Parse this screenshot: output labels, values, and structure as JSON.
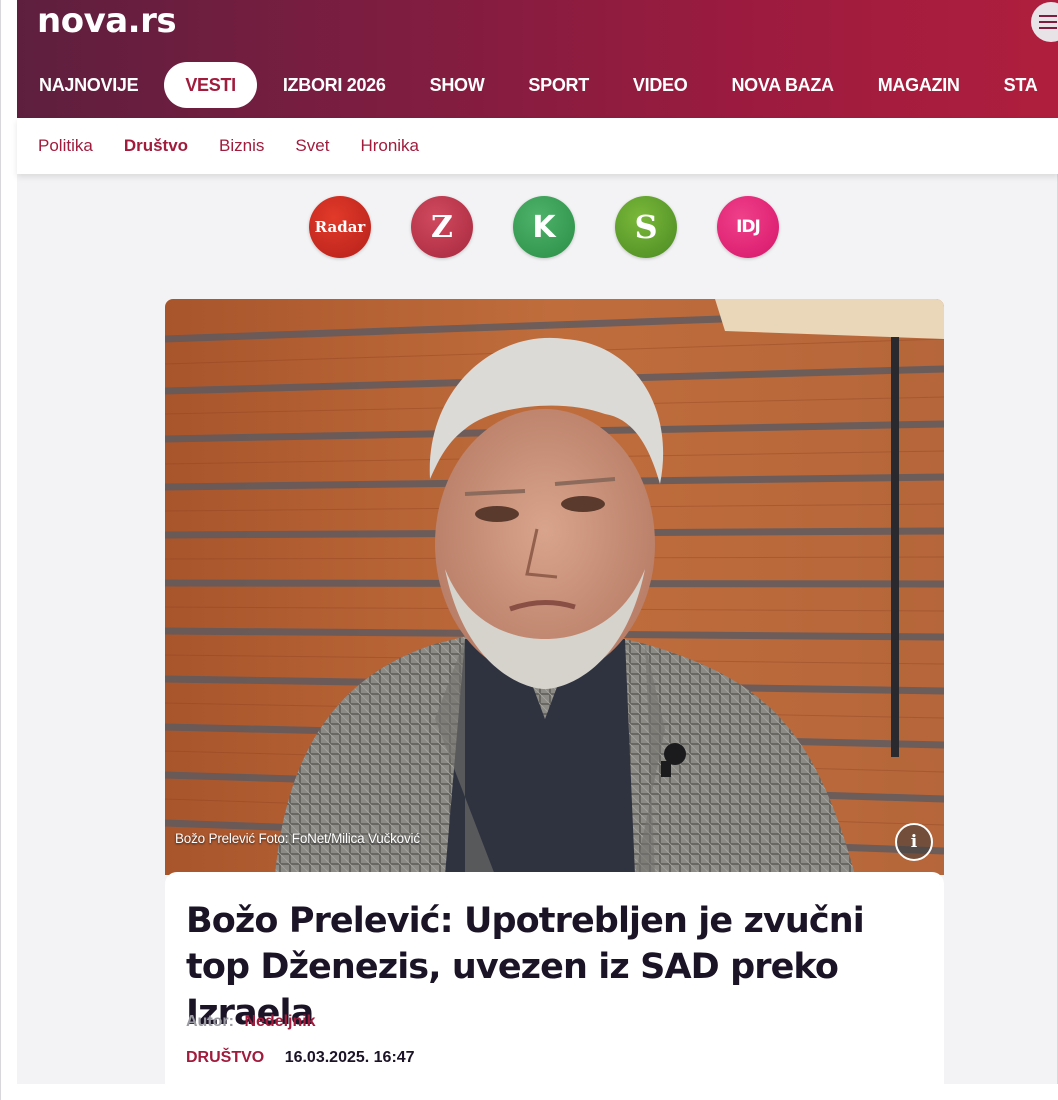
{
  "site": {
    "logo": "nova.rs"
  },
  "icons": {
    "menu": "hamburger-menu-icon",
    "info": "info-icon"
  },
  "colors": {
    "brand": "#a11b3c",
    "header_gradient_start": "#5e1f3e",
    "header_gradient_end": "#b01e3d",
    "title_text": "#1b1326"
  },
  "nav": {
    "items": [
      {
        "label": "NAJNOVIJE",
        "active": false
      },
      {
        "label": "VESTI",
        "active": true
      },
      {
        "label": "IZBORI 2026",
        "active": false
      },
      {
        "label": "SHOW",
        "active": false
      },
      {
        "label": "SPORT",
        "active": false
      },
      {
        "label": "VIDEO",
        "active": false
      },
      {
        "label": "NOVA BAZA",
        "active": false
      },
      {
        "label": "MAGAZIN",
        "active": false
      },
      {
        "label": "STA",
        "active": false
      }
    ]
  },
  "subnav": {
    "items": [
      {
        "label": "Politika",
        "active": false
      },
      {
        "label": "Društvo",
        "active": true
      },
      {
        "label": "Biznis",
        "active": false
      },
      {
        "label": "Svet",
        "active": false
      },
      {
        "label": "Hronika",
        "active": false
      }
    ]
  },
  "partners": [
    {
      "label": "Radar",
      "name": "radar"
    },
    {
      "label": "Z",
      "name": "zurnal"
    },
    {
      "label": "K",
      "name": "k"
    },
    {
      "label": "S",
      "name": "s"
    },
    {
      "label": "IDJ",
      "name": "idj"
    }
  ],
  "article": {
    "image_caption": "Božo Prelević Foto: FoNet/Milica Vučković",
    "info_label": "i",
    "title": "Božo Prelević: Upotrebljen je zvučni top Dženezis, uvezen iz SAD preko Izraela",
    "author_label": "Autor:",
    "author_name": "Nedeljnik",
    "category": "DRUŠTVO",
    "date": "16.03.2025. 16:47"
  }
}
